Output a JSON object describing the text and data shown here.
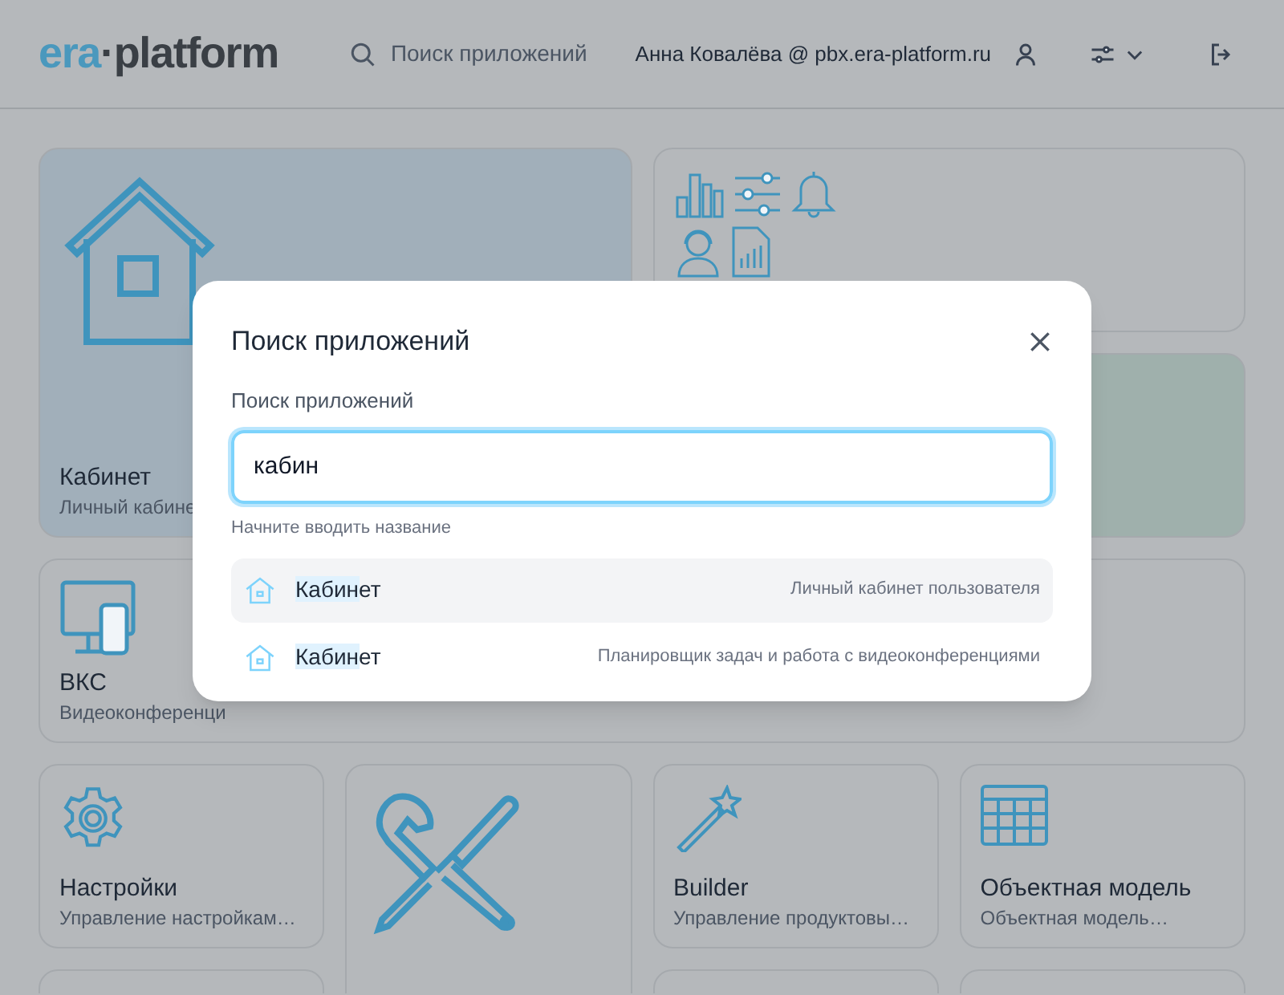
{
  "header": {
    "logo": {
      "accent": "era",
      "rest": "·platform"
    },
    "search_label": "Поиск приложений",
    "user": "Анна Ковалёва @ pbx.era-platform.ru"
  },
  "tiles": [
    {
      "kind": "home",
      "title": "Кабинет",
      "subtitle": "Личный кабине",
      "color": "#a1afba"
    },
    {
      "kind": "widgets",
      "color": "#b5b8bb"
    },
    {
      "kind": "blank",
      "color": "#9fb0ac"
    },
    {
      "kind": "video",
      "title": "ВКС",
      "subtitle": "Видеоконференци",
      "color": "#b5b8bb"
    },
    {
      "kind": "gear",
      "title": "Настройки",
      "subtitle": "Управление настройкам…",
      "color": "#b5b8bb"
    },
    {
      "kind": "tools",
      "color": "#b5b8bb"
    },
    {
      "kind": "wand",
      "title": "Builder",
      "subtitle": "Управление продуктовы…",
      "color": "#b5b8bb"
    },
    {
      "kind": "table",
      "title": "Объектная модель",
      "subtitle": "Объектная модель…",
      "color": "#b5b8bb"
    },
    {
      "kind": "partial",
      "color": "#b5b8bb"
    },
    {
      "kind": "partial",
      "color": "#b5b8bb"
    },
    {
      "kind": "partial",
      "color": "#b5b8bb"
    }
  ],
  "dialog": {
    "title": "Поиск приложений",
    "field_label": "Поиск приложений",
    "value": "кабин",
    "hint": "Начните вводить название",
    "results": [
      {
        "match": "Кабин",
        "rest": "ет",
        "description": "Личный кабинет пользователя",
        "selected": true
      },
      {
        "match": "Кабин",
        "rest": "ет",
        "description": "Планировщик задач и работа с видеоконференциями",
        "selected": false
      }
    ]
  }
}
